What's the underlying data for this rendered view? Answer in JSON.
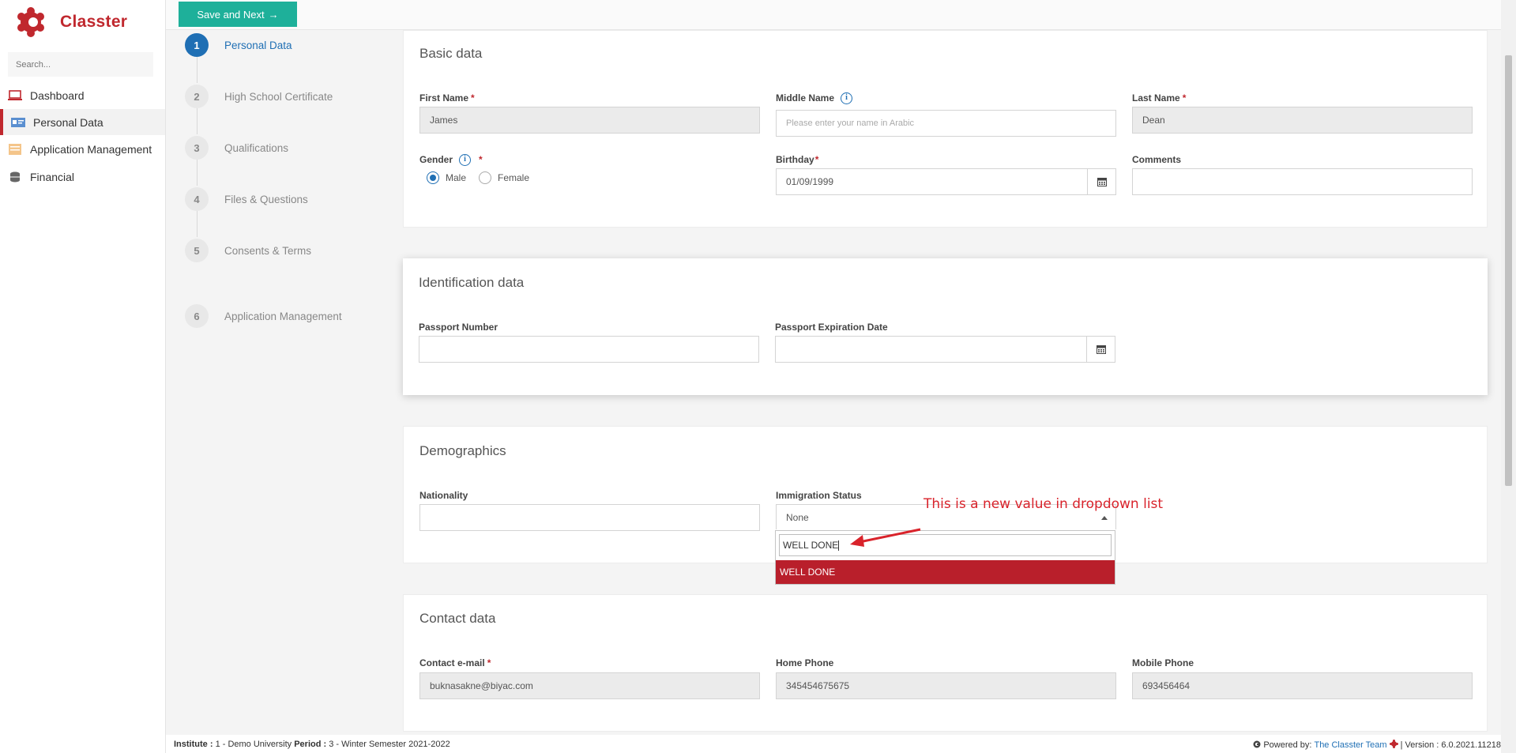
{
  "app": {
    "name": "Classter"
  },
  "sidebar": {
    "search_placeholder": "Search...",
    "items": [
      {
        "label": "Dashboard",
        "icon": "laptop-icon"
      },
      {
        "label": "Personal Data",
        "icon": "id-card-icon",
        "active": true
      },
      {
        "label": "Application Management",
        "icon": "folder-icon"
      },
      {
        "label": "Financial",
        "icon": "coins-icon"
      }
    ]
  },
  "toolbar": {
    "save_label": "Save and Next",
    "save_arrow": "→"
  },
  "steps": [
    {
      "num": "1",
      "label": "Personal Data",
      "active": true
    },
    {
      "num": "2",
      "label": "High School Certificate"
    },
    {
      "num": "3",
      "label": "Qualifications"
    },
    {
      "num": "4",
      "label": "Files & Questions"
    },
    {
      "num": "5",
      "label": "Consents & Terms"
    },
    {
      "num": "6",
      "label": "Application Management"
    }
  ],
  "basic": {
    "title": "Basic data",
    "first_name": {
      "label": "First Name",
      "value": "James"
    },
    "middle_name": {
      "label": "Middle Name",
      "placeholder": "Please enter your name in Arabic"
    },
    "last_name": {
      "label": "Last Name",
      "value": "Dean"
    },
    "gender": {
      "label": "Gender",
      "options": [
        "Male",
        "Female"
      ],
      "selected": "Male"
    },
    "birthday": {
      "label": "Birthday",
      "value": "01/09/1999"
    },
    "comments": {
      "label": "Comments",
      "value": ""
    }
  },
  "identification": {
    "title": "Identification data",
    "passport_number": {
      "label": "Passport Number",
      "value": ""
    },
    "passport_expiration": {
      "label": "Passport Expiration Date",
      "value": ""
    }
  },
  "demographics": {
    "title": "Demographics",
    "nationality": {
      "label": "Nationality",
      "value": ""
    },
    "immigration_status": {
      "label": "Immigration Status",
      "value": "None",
      "search_text": "WELL DONE",
      "highlighted_option": "WELL DONE"
    }
  },
  "annotation": {
    "text": "This is a new value in dropdown list",
    "color": "#d9232b"
  },
  "contact": {
    "title": "Contact data",
    "email": {
      "label": "Contact e-mail",
      "value": "buknasakne@biyac.com"
    },
    "home_phone": {
      "label": "Home Phone",
      "value": "345454675675"
    },
    "mobile_phone": {
      "label": "Mobile Phone",
      "value": "693456464"
    }
  },
  "footer": {
    "institute_label": "Institute :",
    "institute_value": "1 - Demo University",
    "period_label": "Period :",
    "period_value": "3 - Winter Semester 2021-2022",
    "powered_by": "Powered by:",
    "team": "The Classter Team",
    "version": "| Version : 6.0.2021.11218"
  },
  "colors": {
    "brand": "#c0282e",
    "accent": "#1eb09a",
    "primary": "#1f6fb4",
    "highlight": "#b91f2b"
  }
}
